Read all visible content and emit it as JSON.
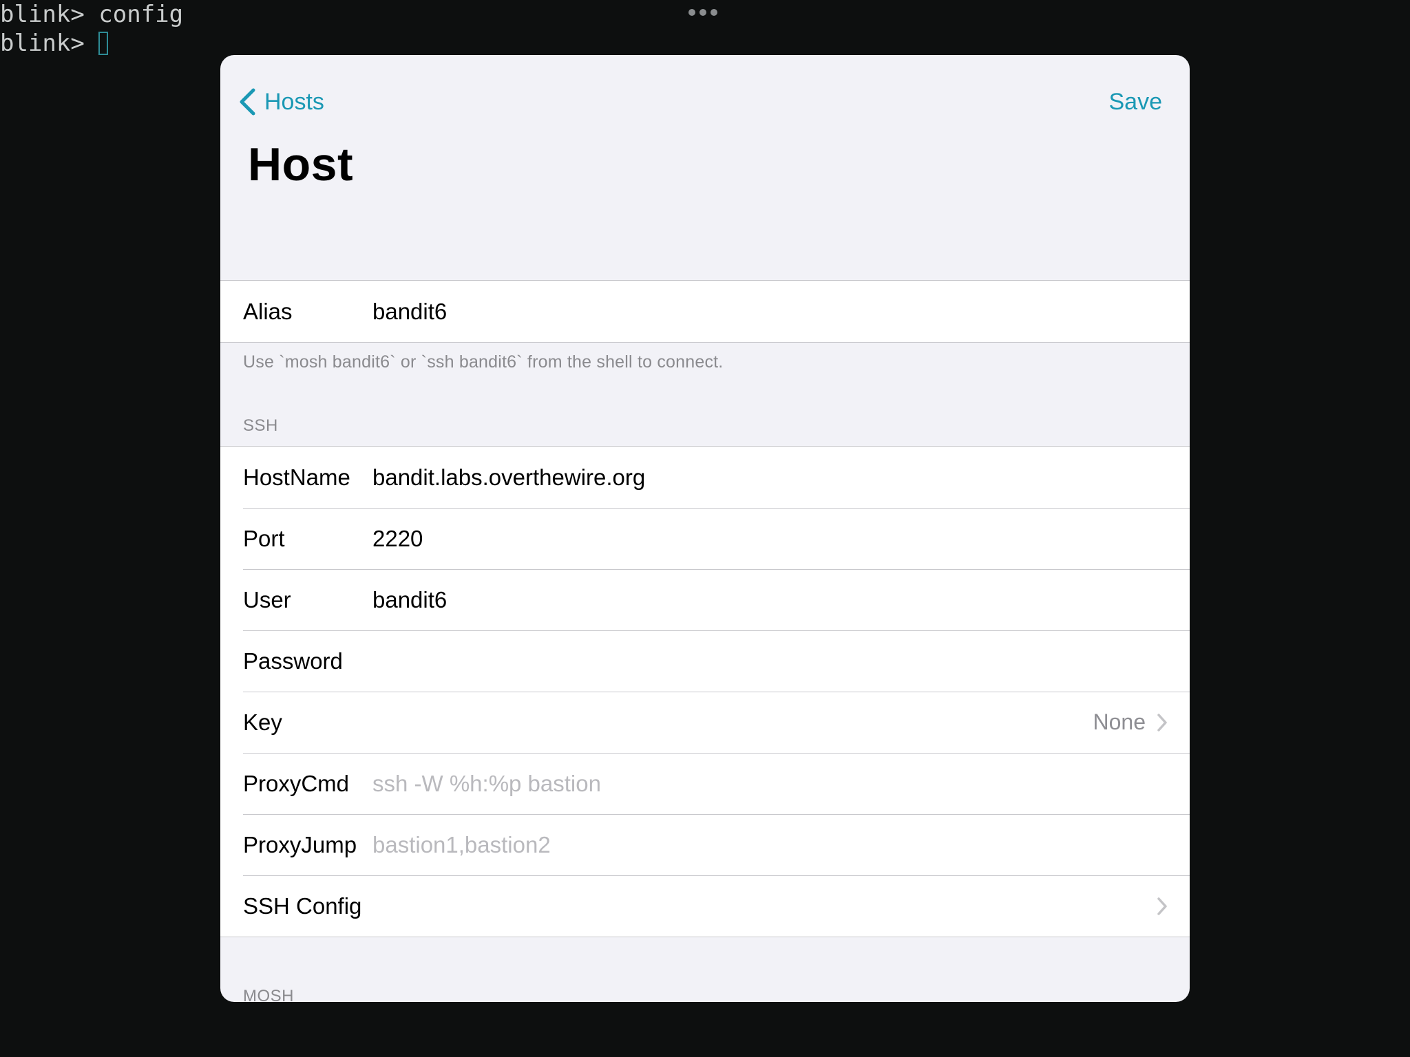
{
  "terminal": {
    "lines": [
      "blink> config",
      "blink> "
    ]
  },
  "sheet": {
    "back_label": "Hosts",
    "save_label": "Save",
    "title": "Host",
    "alias": {
      "label": "Alias",
      "value": "bandit6",
      "footer": "Use `mosh bandit6` or `ssh bandit6` from the shell to connect."
    },
    "ssh": {
      "header": "SSH",
      "hostname": {
        "label": "HostName",
        "value": "bandit.labs.overthewire.org"
      },
      "port": {
        "label": "Port",
        "value": "2220"
      },
      "user": {
        "label": "User",
        "value": "bandit6"
      },
      "password": {
        "label": "Password",
        "value": ""
      },
      "key": {
        "label": "Key",
        "value": "None"
      },
      "proxycmd": {
        "label": "ProxyCmd",
        "placeholder": "ssh -W %h:%p bastion"
      },
      "proxyjump": {
        "label": "ProxyJump",
        "placeholder": "bastion1,bastion2"
      },
      "sshconfig": {
        "label": "SSH Config"
      }
    },
    "mosh": {
      "header": "MOSH"
    }
  },
  "colors": {
    "accent": "#1a98b4",
    "terminal_bg": "#0d0f0f",
    "cursor": "#2e8c96",
    "sheet_bg": "#f2f2f7"
  }
}
